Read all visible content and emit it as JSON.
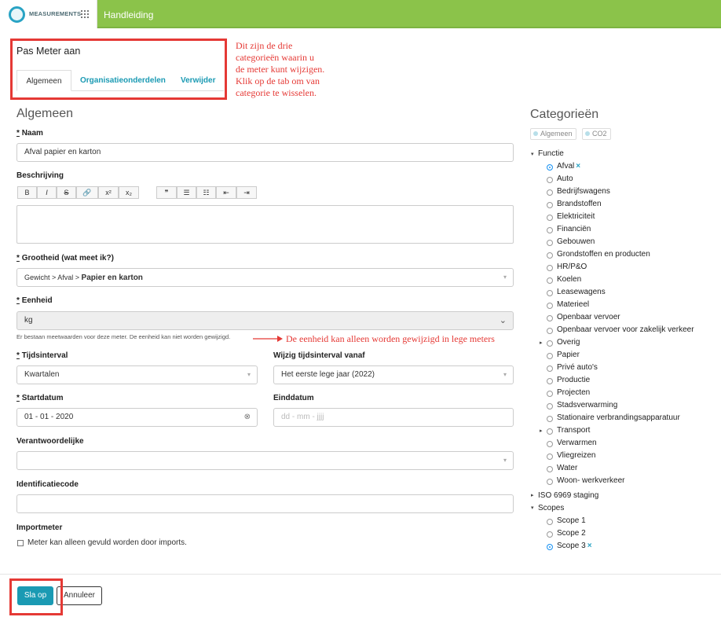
{
  "topbar": {
    "brand": "MEASUREMENTS",
    "help": "Handleiding"
  },
  "page": {
    "title": "Pas Meter aan"
  },
  "tabs": [
    {
      "label": "Algemeen"
    },
    {
      "label": "Organisatieonderdelen"
    },
    {
      "label": "Verwijder"
    }
  ],
  "annotations": {
    "tabs_note": [
      "Dit zijn de drie",
      "categorieën waarin u",
      "de meter kunt wijzigen.",
      "Klik op de tab om van",
      "categorie te wisselen."
    ],
    "unit_note": "De eenheid kan alleen worden gewijzigd in lege meters"
  },
  "form": {
    "section": "Algemeen",
    "name_label": "Naam",
    "name_value": "Afval papier en karton",
    "description_label": "Beschrijving",
    "toolbar": [
      "B",
      "I",
      "S",
      "🔗",
      "x²",
      "x₂",
      "❞",
      "☰",
      "☷",
      "⇤",
      "⇥"
    ],
    "quantity_label": "Grootheid (wat meet ik?)",
    "quantity_path": "Gewicht > Afval > ",
    "quantity_value": "Papier en karton",
    "unit_label": "Eenheid",
    "unit_value": "kg",
    "unit_hint": "Er bestaan meetwaarden voor deze meter. De eenheid kan niet worden gewijzigd.",
    "interval_label": "Tijdsinterval",
    "interval_value": "Kwartalen",
    "interval_change_label": "Wijzig tijdsinterval vanaf",
    "interval_change_value": "Het eerste lege jaar (2022)",
    "start_label": "Startdatum",
    "start_value": "01 - 01 - 2020",
    "end_label": "Einddatum",
    "end_placeholder": "dd - mm - jjjj",
    "responsible_label": "Verantwoordelijke",
    "identification_label": "Identificatiecode",
    "import_label": "Importmeter",
    "import_checkbox": "Meter kan alleen gevuld worden door imports."
  },
  "categories": {
    "title": "Categorieën",
    "chips": [
      "Algemeen",
      "CO2"
    ],
    "functie": "Functie",
    "items": [
      "Afval",
      "Auto",
      "Bedrijfswagens",
      "Brandstoffen",
      "Elektriciteit",
      "Financiën",
      "Gebouwen",
      "Grondstoffen en producten",
      "HR/P&O",
      "Koelen",
      "Leasewagens",
      "Materieel",
      "Openbaar vervoer",
      "Openbaar vervoer voor zakelijk verkeer",
      "Overig",
      "Papier",
      "Privé auto's",
      "Productie",
      "Projecten",
      "Stadsverwarming",
      "Stationaire verbrandingsapparatuur",
      "Transport",
      "Verwarmen",
      "Vliegreizen",
      "Water",
      "Woon- werkverkeer"
    ],
    "iso": "ISO 6969 staging",
    "scopes": "Scopes",
    "scope_items": [
      "Scope 1",
      "Scope 2",
      "Scope 3"
    ],
    "x_mark": "×"
  },
  "buttons": {
    "save": "Sla op",
    "cancel": "Annuleer"
  },
  "colors": {
    "topbar": "#8bc34a",
    "accent": "#1a9ab3",
    "annotation": "#e53935"
  }
}
